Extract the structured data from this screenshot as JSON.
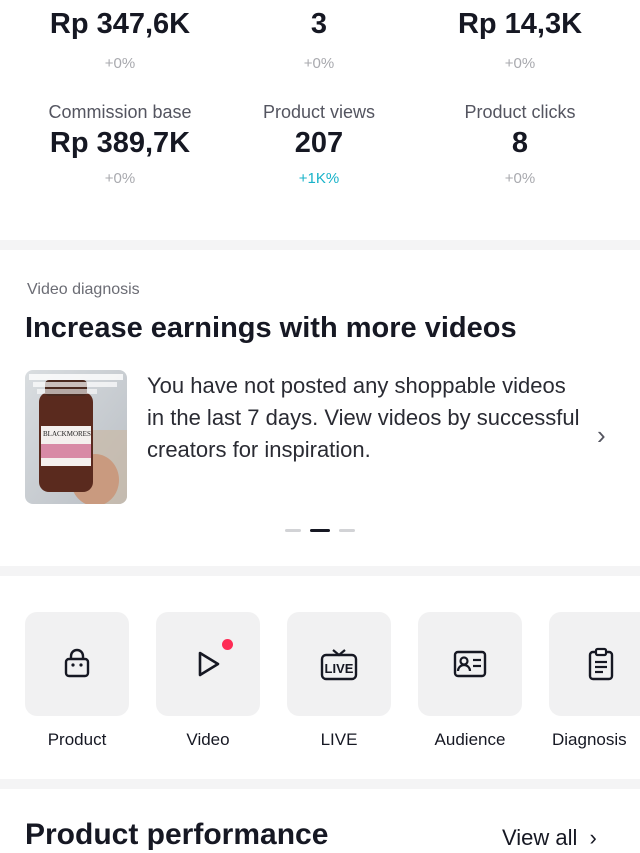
{
  "stats_row1": [
    {
      "value": "Rp 347,6K",
      "change": "+0%"
    },
    {
      "value": "3",
      "change": "+0%"
    },
    {
      "value": "Rp 14,3K",
      "change": "+0%"
    }
  ],
  "stats_row2": [
    {
      "label": "Commission base",
      "value": "Rp 389,7K",
      "change": "+0%"
    },
    {
      "label": "Product views",
      "value": "207",
      "change": "+1K%"
    },
    {
      "label": "Product clicks",
      "value": "8",
      "change": "+0%"
    }
  ],
  "diagnosis": {
    "tag": "Video diagnosis",
    "title": "Increase earnings with more videos",
    "body": "You have not posted any shoppable videos in the last 7 days. View videos by successful creators for inspiration.",
    "thumbnail_label": "BLACKMORES"
  },
  "tools": [
    {
      "label": "Product",
      "icon": "shopping-bag-icon"
    },
    {
      "label": "Video",
      "icon": "play-icon"
    },
    {
      "label": "LIVE",
      "icon": "live-tv-icon",
      "icon_text": "LIVE"
    },
    {
      "label": "Audience",
      "icon": "id-card-icon"
    },
    {
      "label": "Diagnosis",
      "icon": "clipboard-icon"
    }
  ],
  "product_performance": {
    "title": "Product performance",
    "view_all": "View all"
  },
  "colors": {
    "accent_teal": "#19b3c9",
    "notification_red": "#fe2c55",
    "tile_bg": "#f1f1f2"
  }
}
